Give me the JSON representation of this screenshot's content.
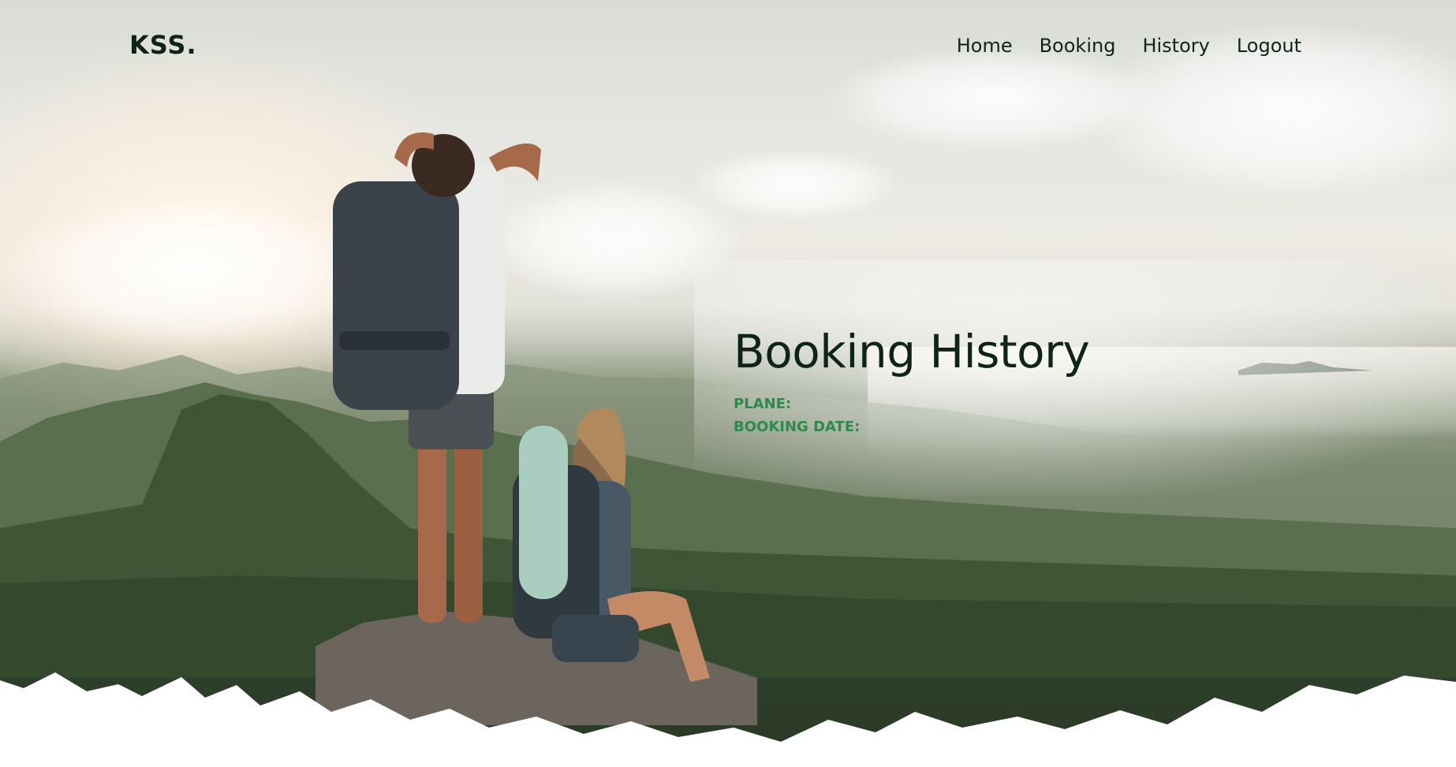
{
  "header": {
    "brand": "KSS.",
    "nav": [
      {
        "label": "Home"
      },
      {
        "label": "Booking"
      },
      {
        "label": "History"
      },
      {
        "label": "Logout"
      }
    ]
  },
  "main": {
    "title": "Booking History",
    "details": [
      {
        "label": "PLANE:",
        "value": ""
      },
      {
        "label": "BOOKING DATE:",
        "value": ""
      }
    ]
  },
  "colors": {
    "brand_text": "#10231a",
    "title_text": "#0f2419",
    "detail_label": "#2e8a4a"
  },
  "background": {
    "description_icon": "hikers-landscape-image"
  }
}
